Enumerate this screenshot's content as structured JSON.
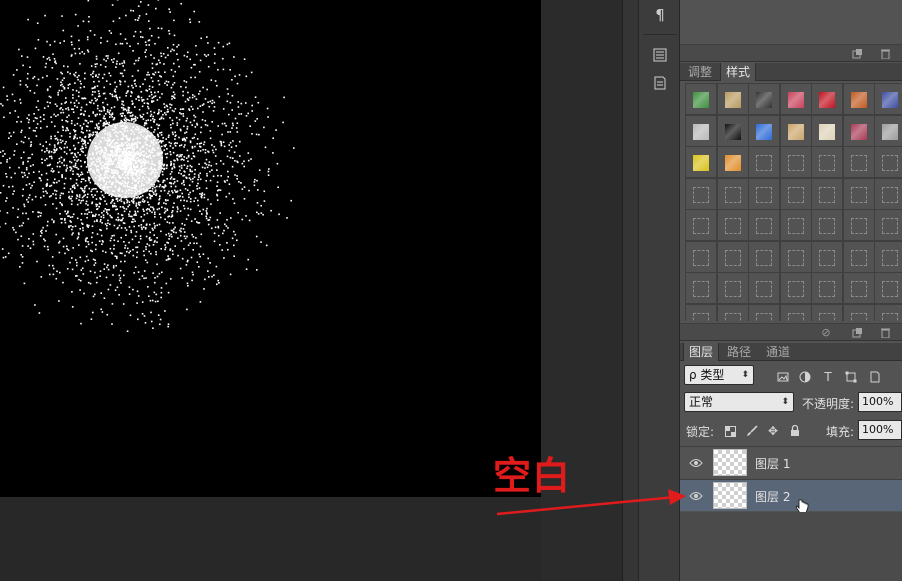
{
  "paragraph_strip": {
    "icons": [
      "paragraph-icon",
      "character-panel-icon",
      "paragraph-style-icon"
    ]
  },
  "styles_panel": {
    "tabs": [
      {
        "label": "调整",
        "active": false
      },
      {
        "label": "样式",
        "active": true
      }
    ],
    "swatch_colors": [
      [
        "#3a8f3c",
        "#b99a5f",
        "#333333",
        "#c8405a",
        "#c1121f",
        "#c0591f",
        "#3e4fa3"
      ],
      [
        "#b8b8b8",
        "#111111",
        "#2e6bd6",
        "#c9a56a",
        "#ddd2b8",
        "#a83a55",
        "#9c9c9c"
      ],
      [
        "#d8c21a",
        "#e08e2c",
        "",
        "",
        "",
        "",
        ""
      ]
    ]
  },
  "layers_panel": {
    "tabs": [
      {
        "label": "图层",
        "active": true
      },
      {
        "label": "路径",
        "active": false
      },
      {
        "label": "通道",
        "active": false
      }
    ],
    "filter_kind": "ρ 类型",
    "blend_mode": "正常",
    "opacity_label": "不透明度:",
    "opacity_value": "100%",
    "lock_label": "锁定:",
    "fill_label": "填充:",
    "fill_value": "100%",
    "layers": [
      {
        "name": "图层 1",
        "selected": false
      },
      {
        "name": "图层 2",
        "selected": true
      }
    ]
  },
  "annotation": {
    "text": "空白",
    "color": "#e01b1b"
  }
}
